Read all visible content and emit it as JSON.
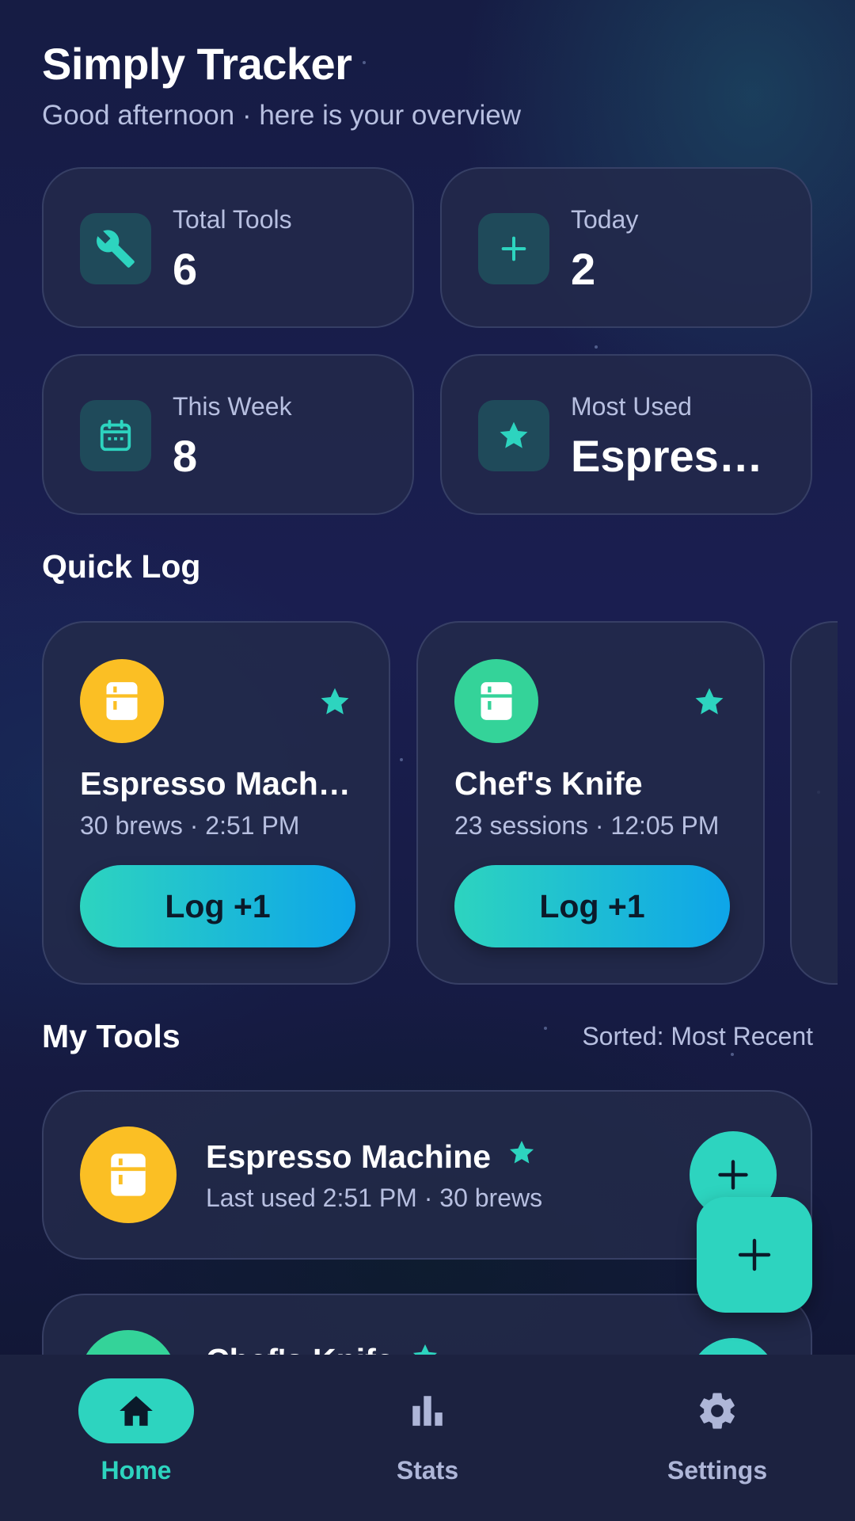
{
  "header": {
    "title": "Simply Tracker",
    "subtitle": "Good afternoon · here is your overview"
  },
  "stats": [
    {
      "label": "Total Tools",
      "value": "6",
      "icon": "wrench-icon"
    },
    {
      "label": "Today",
      "value": "2",
      "icon": "plus-icon"
    },
    {
      "label": "This Week",
      "value": "8",
      "icon": "calendar-icon"
    },
    {
      "label": "Most Used",
      "value": "Espresso Machine",
      "icon": "star-icon"
    }
  ],
  "quick_log": {
    "title": "Quick Log",
    "items": [
      {
        "name": "Espresso Machine",
        "meta": "30 brews · 2:51 PM",
        "button": "Log +1",
        "color": "#fbbf24",
        "favorite": true
      },
      {
        "name": "Chef's Knife",
        "meta": "23 sessions · 12:05 PM",
        "button": "Log +1",
        "color": "#34d399",
        "favorite": true
      }
    ]
  },
  "my_tools": {
    "title": "My Tools",
    "sort": "Sorted: Most Recent",
    "items": [
      {
        "name": "Espresso Machine",
        "meta": "Last used 2:51 PM · 30 brews",
        "color": "#fbbf24",
        "favorite": true
      },
      {
        "name": "Chef's Knife",
        "meta": "",
        "color": "#34d399",
        "favorite": true
      }
    ]
  },
  "nav": {
    "items": [
      {
        "label": "Home",
        "icon": "home-icon",
        "active": true
      },
      {
        "label": "Stats",
        "icon": "bar-chart-icon",
        "active": false
      },
      {
        "label": "Settings",
        "icon": "gear-icon",
        "active": false
      }
    ]
  },
  "colors": {
    "accent": "#2dd4bf",
    "gradient_end": "#0ea5e9",
    "card": "#232a4a",
    "muted_text": "#b7bfe0"
  }
}
